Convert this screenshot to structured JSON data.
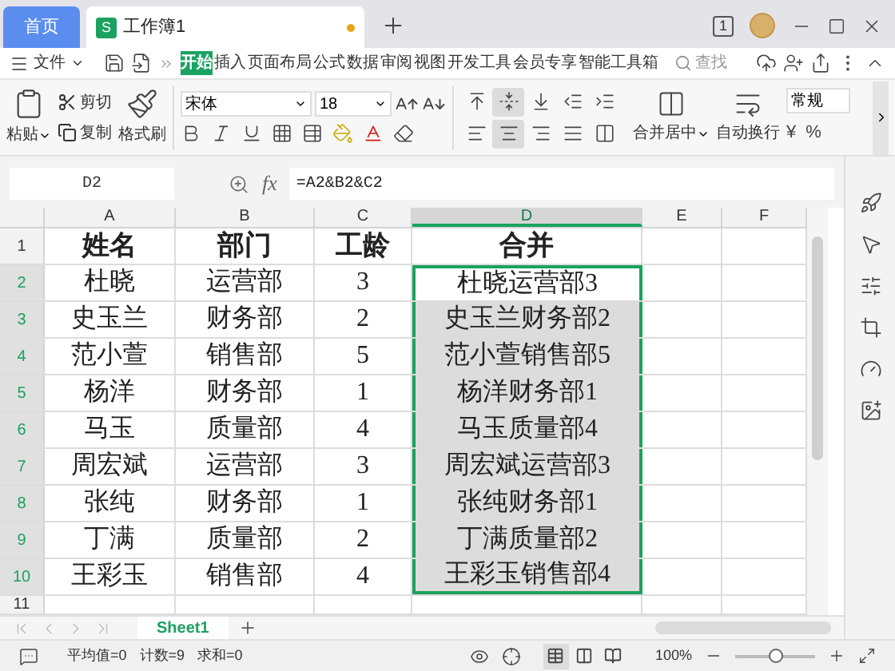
{
  "tabs": [
    {
      "label": "首页",
      "kind": "home",
      "selected": false
    },
    {
      "label": "工作簿1",
      "kind": "document",
      "badge": "S",
      "modified": true,
      "selected": true
    }
  ],
  "window_badge": "1",
  "menu": {
    "file": "文件",
    "ribbon_tabs": [
      {
        "label": "开始",
        "selected": true
      },
      {
        "label": "插入",
        "selected": false
      },
      {
        "label": "页面布局",
        "selected": false
      },
      {
        "label": "公式",
        "selected": false
      },
      {
        "label": "数据",
        "selected": false
      },
      {
        "label": "审阅",
        "selected": false
      },
      {
        "label": "视图",
        "selected": false
      },
      {
        "label": "开发工具",
        "selected": false
      },
      {
        "label": "会员专享",
        "selected": false
      },
      {
        "label": "智能工具箱",
        "selected": false
      }
    ],
    "search": {
      "placeholder": "查找"
    }
  },
  "ribbon": {
    "paste": "粘贴",
    "cut": "剪切",
    "copy": "复制",
    "format_painter": "格式刷",
    "font": "宋体",
    "font_size": "18",
    "merge": "合并居中",
    "wrap": "自动换行",
    "number_format": "常规",
    "currency": "¥",
    "percent": "%",
    "align_buttons": [
      {
        "kind": "top",
        "selected": false
      },
      {
        "kind": "middle",
        "selected": true
      },
      {
        "kind": "bottom",
        "selected": false
      },
      {
        "kind": "outdent",
        "selected": false
      },
      {
        "kind": "indent",
        "selected": false
      },
      {
        "kind": "left",
        "selected": false
      },
      {
        "kind": "center",
        "selected": true
      },
      {
        "kind": "right",
        "selected": false
      },
      {
        "kind": "justify",
        "selected": false
      },
      {
        "kind": "distributed",
        "selected": false
      }
    ]
  },
  "formula_bar": {
    "name_box": "D2",
    "fx": "fx",
    "formula": "=A2&B2&C2"
  },
  "table": {
    "columns": [
      {
        "label": "A",
        "selected": false
      },
      {
        "label": "B",
        "selected": false
      },
      {
        "label": "C",
        "selected": false
      },
      {
        "label": "D",
        "selected": true
      },
      {
        "label": "E",
        "selected": false
      },
      {
        "label": "F",
        "selected": false
      }
    ],
    "rows": [
      {
        "number": "1",
        "kind": "header",
        "selected": false,
        "cells": [
          "姓名",
          "部门",
          "工龄",
          "合并"
        ]
      },
      {
        "number": "2",
        "kind": "data",
        "selected": true,
        "cells": [
          "杜晓",
          "运营部",
          "3",
          "杜晓运营部3"
        ]
      },
      {
        "number": "3",
        "kind": "data",
        "selected": true,
        "cells": [
          "史玉兰",
          "财务部",
          "2",
          "史玉兰财务部2"
        ]
      },
      {
        "number": "4",
        "kind": "data",
        "selected": true,
        "cells": [
          "范小萱",
          "销售部",
          "5",
          "范小萱销售部5"
        ]
      },
      {
        "number": "5",
        "kind": "data",
        "selected": true,
        "cells": [
          "杨洋",
          "财务部",
          "1",
          "杨洋财务部1"
        ]
      },
      {
        "number": "6",
        "kind": "data",
        "selected": true,
        "cells": [
          "马玉",
          "质量部",
          "4",
          "马玉质量部4"
        ]
      },
      {
        "number": "7",
        "kind": "data",
        "selected": true,
        "cells": [
          "周宏斌",
          "运营部",
          "3",
          "周宏斌运营部3"
        ]
      },
      {
        "number": "8",
        "kind": "data",
        "selected": true,
        "cells": [
          "张纯",
          "财务部",
          "1",
          "张纯财务部1"
        ]
      },
      {
        "number": "9",
        "kind": "data",
        "selected": true,
        "cells": [
          "丁满",
          "质量部",
          "2",
          "丁满质量部2"
        ]
      },
      {
        "number": "10",
        "kind": "data",
        "selected": true,
        "cells": [
          "王彩玉",
          "销售部",
          "4",
          "王彩玉销售部4"
        ]
      },
      {
        "number": "11",
        "kind": "cut",
        "selected": false,
        "cells": []
      }
    ]
  },
  "sheet_tabs": [
    {
      "label": "Sheet1",
      "selected": true
    }
  ],
  "status_bar": {
    "stats": [
      "平均值=0",
      "计数=9",
      "求和=0"
    ],
    "views": [
      {
        "kind": "normal",
        "selected": true
      },
      {
        "kind": "page-break",
        "selected": false
      },
      {
        "kind": "reading",
        "selected": false
      }
    ],
    "zoom": "100%",
    "zoom_slider": {
      "level": 0.5
    }
  }
}
